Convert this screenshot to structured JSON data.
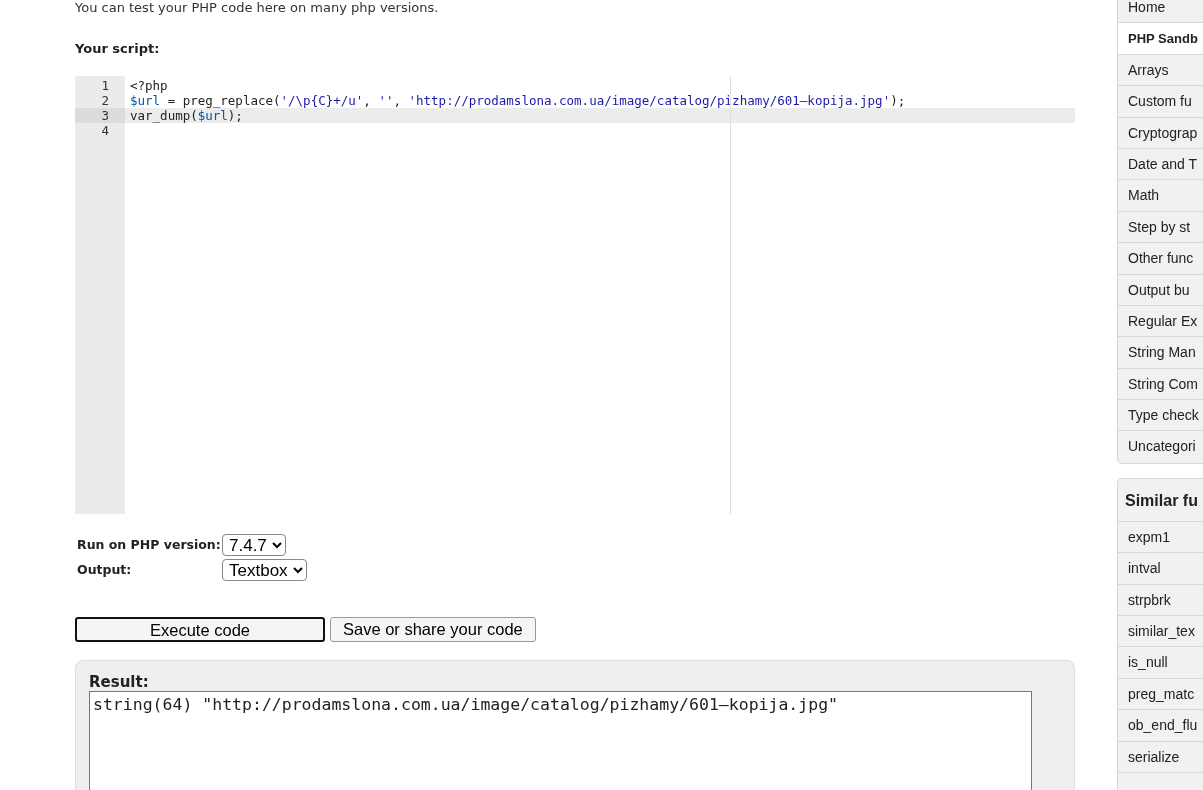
{
  "intro": "You can test your PHP code here on many php versions.",
  "script_label": "Your script:",
  "editor": {
    "lines": [
      {
        "number": "1",
        "active": false,
        "tokens": [
          {
            "kind": "plain",
            "text": "<?php"
          }
        ]
      },
      {
        "number": "2",
        "active": false,
        "tokens": [
          {
            "kind": "variable",
            "text": "$url"
          },
          {
            "kind": "plain",
            "text": " = preg_replace("
          },
          {
            "kind": "string",
            "text": "'/\\p{C}+/u'"
          },
          {
            "kind": "plain",
            "text": ", "
          },
          {
            "kind": "string",
            "text": "''"
          },
          {
            "kind": "plain",
            "text": ", "
          },
          {
            "kind": "string",
            "text": "'http://prodamslona.com.ua/image/catalog/pizhamy/601—kopija.jpg'"
          },
          {
            "kind": "plain",
            "text": ");"
          }
        ]
      },
      {
        "number": "3",
        "active": true,
        "tokens": [
          {
            "kind": "plain",
            "text": "var_dump("
          },
          {
            "kind": "variable",
            "text": "$url"
          },
          {
            "kind": "plain",
            "text": ");"
          }
        ]
      },
      {
        "number": "4",
        "active": false
      }
    ]
  },
  "options": [
    {
      "label": "Run on PHP version:",
      "value": "7.4.7"
    },
    {
      "label": "Output:",
      "value": "Textbox"
    }
  ],
  "buttons": [
    {
      "label": "Execute code",
      "focused": true
    },
    {
      "label": "Save or share your code",
      "focused": false
    }
  ],
  "result": {
    "title": "Result:",
    "output": "string(64) \"http://prodamslona.com.ua/image/catalog/pizhamy/601—kopija.jpg\""
  },
  "sidebar": {
    "items": [
      {
        "label": "Home",
        "selected": false
      },
      {
        "label": "PHP Sandb",
        "selected": true
      },
      {
        "label": "Arrays",
        "selected": false
      },
      {
        "label": "Custom fu",
        "selected": false
      },
      {
        "label": "Cryptograp",
        "selected": false
      },
      {
        "label": "Date and T",
        "selected": false
      },
      {
        "label": "Math",
        "selected": false
      },
      {
        "label": "Step by st",
        "selected": false
      },
      {
        "label": "Other func",
        "selected": false
      },
      {
        "label": "Output bu",
        "selected": false
      },
      {
        "label": "Regular Ex",
        "selected": false
      },
      {
        "label": "String Man",
        "selected": false
      },
      {
        "label": "String Com",
        "selected": false
      },
      {
        "label": "Type check",
        "selected": false
      },
      {
        "label": "Uncategori",
        "selected": false
      }
    ]
  },
  "similar": {
    "title": "Similar fu",
    "items": [
      "expm1",
      "intval",
      "strpbrk",
      "similar_tex",
      "is_null",
      "preg_matc",
      "ob_end_flu",
      "serialize"
    ]
  }
}
